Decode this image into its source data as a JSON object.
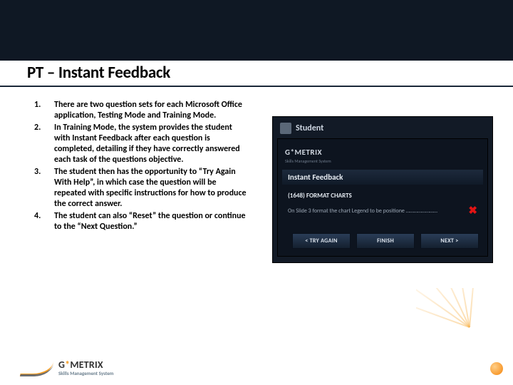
{
  "title": "PT – Instant Feedback",
  "list": [
    {
      "n": "1.",
      "t": "There are two question sets for each Microsoft Office application, Testing Mode and Training Mode."
    },
    {
      "n": "2.",
      "t": "In Training Mode, the system provides the student with Instant Feedback after each question is completed, detailing if they have correctly answered each task of the questions objective."
    },
    {
      "n": "3.",
      "t": "The student then has the opportunity to “Try Again With Help”, in which case the question will be repeated with specific instructions for how to produce the correct answer."
    },
    {
      "n": "4.",
      "t": "The student can also “Reset” the question or continue to the “Next Question.”"
    }
  ],
  "shot": {
    "student": "Student",
    "brand": "G*METRIX",
    "brand_sub": "Skills Management System",
    "panel": "Instant Feedback",
    "qtitle": "(1648) FORMAT CHARTS",
    "qtext": "On Slide 3 format the chart Legend to be positione ……………………",
    "btn_try": "< TRY AGAIN",
    "btn_finish": "FINISH",
    "btn_next": "NEXT >"
  },
  "footer": {
    "brand_a": "G",
    "brand_star": "*",
    "brand_b": "METRIX",
    "sub": "Skills Management System"
  }
}
